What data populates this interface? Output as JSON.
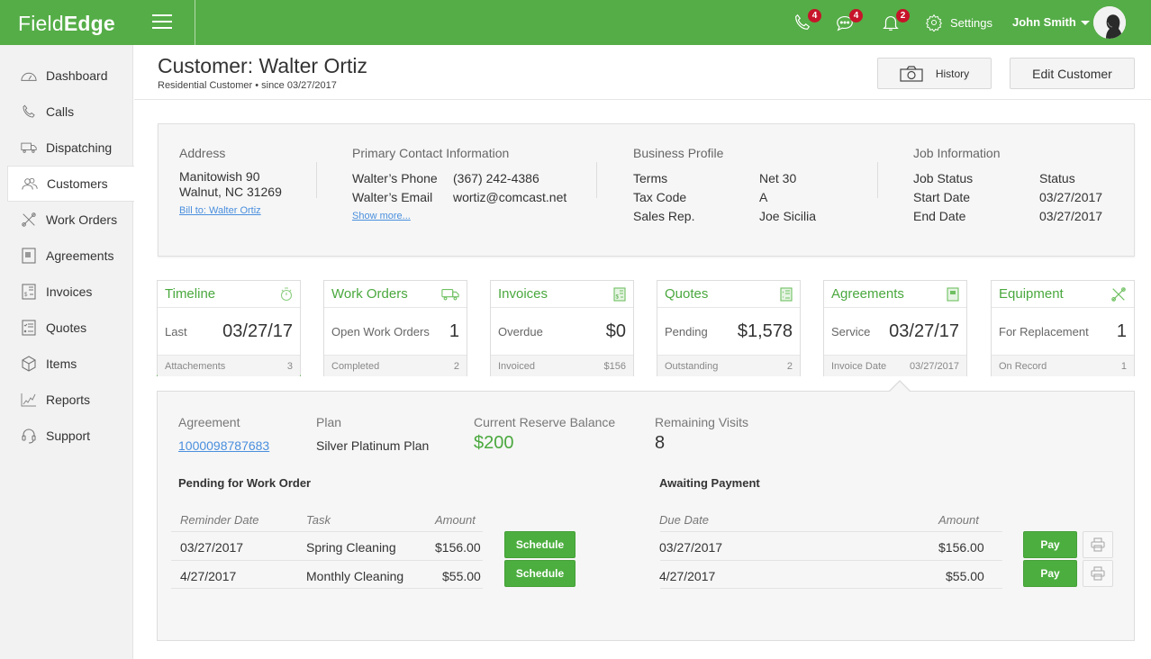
{
  "app": {
    "logo_light": "Field",
    "logo_bold": "Edge",
    "accent_color": "#55ad47",
    "badge_color": "#c7142a"
  },
  "topbar": {
    "calls_badge": "4",
    "messages_badge": "4",
    "notifications_badge": "2",
    "settings_label": "Settings",
    "user_name": "John Smith"
  },
  "sidebar": {
    "items": [
      {
        "label": "Dashboard",
        "icon": "gauge-icon"
      },
      {
        "label": "Calls",
        "icon": "phone-icon"
      },
      {
        "label": "Dispatching",
        "icon": "truck-icon"
      },
      {
        "label": "Customers",
        "icon": "users-icon",
        "active": true
      },
      {
        "label": "Work Orders",
        "icon": "tools-icon"
      },
      {
        "label": "Agreements",
        "icon": "document-icon"
      },
      {
        "label": "Invoices",
        "icon": "invoice-icon"
      },
      {
        "label": "Quotes",
        "icon": "quote-icon"
      },
      {
        "label": "Items",
        "icon": "box-icon"
      },
      {
        "label": "Reports",
        "icon": "chart-icon"
      },
      {
        "label": "Support",
        "icon": "headset-icon"
      }
    ]
  },
  "header": {
    "title": "Customer: Walter Ortiz",
    "subtitle": "Residential Customer • since 03/27/2017",
    "history_label": "History",
    "edit_label": "Edit Customer"
  },
  "info": {
    "address": {
      "heading": "Address",
      "line1": "Manitowish 90",
      "line2": "Walnut, NC 31269",
      "bill_link": "Bill to: Walter Ortiz"
    },
    "contact": {
      "heading": "Primary Contact Information",
      "phone_label": "Walter’s Phone",
      "phone_value": "(367) 242-4386",
      "email_label": "Walter’s Email",
      "email_value": "wortiz@comcast.net",
      "show_more": "Show more..."
    },
    "business": {
      "heading": "Business Profile",
      "rows": [
        {
          "k": "Terms",
          "v": "Net 30"
        },
        {
          "k": "Tax Code",
          "v": "A"
        },
        {
          "k": "Sales Rep.",
          "v": "Joe Sicilia"
        }
      ]
    },
    "job": {
      "heading": "Job Information",
      "rows": [
        {
          "k": "Job Status",
          "v": "Status"
        },
        {
          "k": "Start Date",
          "v": "03/27/2017"
        },
        {
          "k": "End Date",
          "v": "03/27/2017"
        }
      ]
    }
  },
  "tiles": [
    {
      "title": "Timeline",
      "label": "Last",
      "value": "03/27/17",
      "foot_label": "Attachements",
      "foot_value": "3"
    },
    {
      "title": "Work Orders",
      "label": "Open Work Orders",
      "value": "1",
      "foot_label": "Completed",
      "foot_value": "2"
    },
    {
      "title": "Invoices",
      "label": "Overdue",
      "value": "$0",
      "foot_label": "Invoiced",
      "foot_value": "$156"
    },
    {
      "title": "Quotes",
      "label": "Pending",
      "value": "$1,578",
      "foot_label": "Outstanding",
      "foot_value": "2"
    },
    {
      "title": "Agreements",
      "label": "Service",
      "value": "03/27/17",
      "foot_label": "Invoice Date",
      "foot_value": "03/27/2017"
    },
    {
      "title": "Equipment",
      "label": "For Replacement",
      "value": "1",
      "foot_label": "On Record",
      "foot_value": "1"
    }
  ],
  "agreement": {
    "agreement_label": "Agreement",
    "agreement_number": "1000098787683",
    "plan_label": "Plan",
    "plan_value": "Silver Platinum Plan",
    "reserve_label": "Current Reserve Balance",
    "reserve_value": "$200",
    "visits_label": "Remaining Visits",
    "visits_value": "8",
    "pending": {
      "title": "Pending for Work Order",
      "headers": [
        "Reminder Date",
        "Task",
        "Amount"
      ],
      "rows": [
        {
          "date": "03/27/2017",
          "task": "Spring Cleaning",
          "amount": "$156.00",
          "action": "Schedule"
        },
        {
          "date": "4/27/2017",
          "task": "Monthly Cleaning",
          "amount": "$55.00",
          "action": "Schedule"
        }
      ]
    },
    "awaiting": {
      "title": "Awaiting Payment",
      "headers": [
        "Due Date",
        "Amount"
      ],
      "rows": [
        {
          "date": "03/27/2017",
          "amount": "$156.00",
          "action": "Pay"
        },
        {
          "date": "4/27/2017",
          "amount": "$55.00",
          "action": "Pay"
        }
      ]
    }
  }
}
